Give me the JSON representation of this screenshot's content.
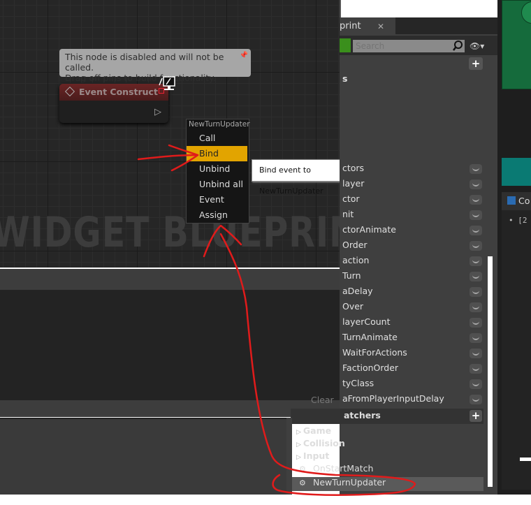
{
  "graph": {
    "watermark": "WIDGET BLUEPRINT",
    "note": {
      "line1": "This node is disabled and will not be called.",
      "line2": "Drag off pins to build functionality."
    },
    "event_node": {
      "title": "Event Construct"
    }
  },
  "context_menu": {
    "title": "NewTurnUpdater",
    "items": [
      "Call",
      "Bind",
      "Unbind",
      "Unbind all",
      "Event",
      "Assign"
    ],
    "selected": "Bind",
    "tooltip": "Bind event to NewTurnUpdater"
  },
  "compiler_results": {
    "clear_label": "Clear"
  },
  "my_blueprint": {
    "tab_label": "print",
    "search_placeholder": "Search",
    "section_stub": "s",
    "variables": [
      "ctors",
      "layer",
      "ctor",
      "nit",
      "ctorAnimate",
      "Order",
      "action",
      "Turn",
      "aDelay",
      "Over",
      "layerCount",
      "TurnAnimate",
      "WaitForActions",
      "FactionOrder",
      "tyClass",
      "aFromPlayerInputDelay"
    ],
    "dispatchers_header": "atchers",
    "categories": [
      "Game",
      "Collision",
      "Input"
    ],
    "dispatchers": [
      "OnStartMatch",
      "NewTurnUpdater"
    ]
  },
  "output_log": {
    "tab_label": "Co",
    "line": "• [2"
  },
  "colors": {
    "menu_highlight": "#e2a400",
    "annotation_red": "#e01b1b",
    "graph_bg": "#262626"
  }
}
